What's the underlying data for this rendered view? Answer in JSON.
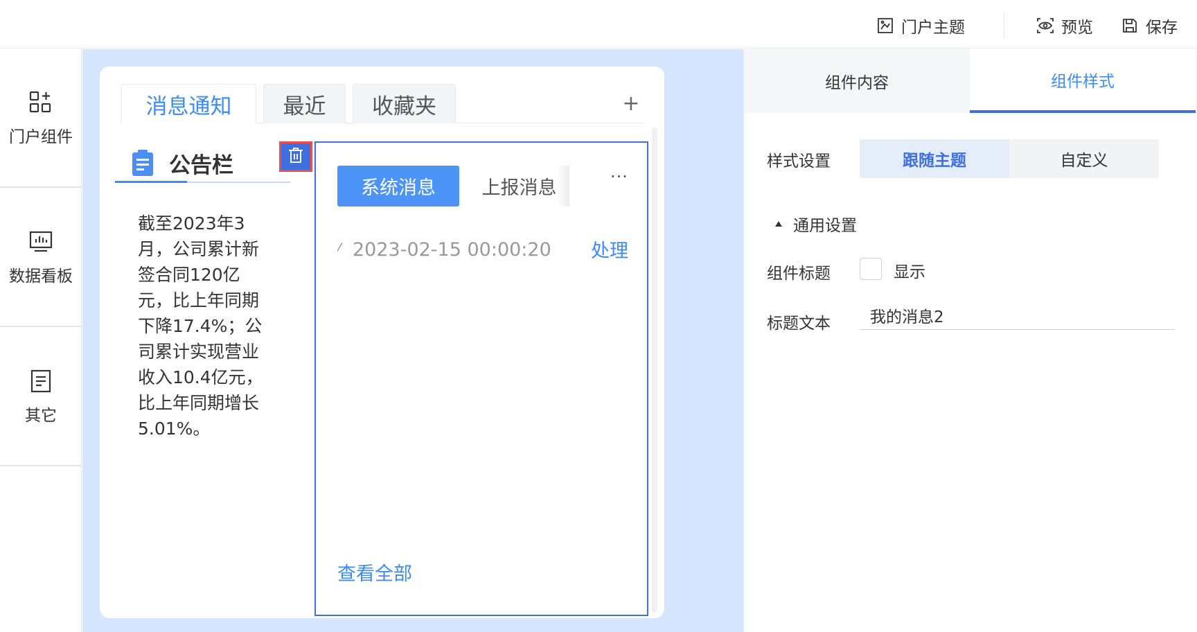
{
  "topbar": {
    "theme_label": "门户主题",
    "preview_label": "预览",
    "save_label": "保存"
  },
  "sidebar": {
    "items": [
      {
        "label": "门户组件",
        "icon": "widgets-icon"
      },
      {
        "label": "数据看板",
        "icon": "dashboard-icon"
      },
      {
        "label": "其它",
        "icon": "document-icon"
      }
    ]
  },
  "canvas": {
    "tabs": [
      {
        "label": "消息通知",
        "active": true
      },
      {
        "label": "最近",
        "active": false
      },
      {
        "label": "收藏夹",
        "active": false
      }
    ],
    "add_tab": "+",
    "bulletin": {
      "title": "公告栏",
      "body": "截至2023年3月，公司累计新签合同120亿元，比上年同期下降17.4%；公司累计实现营业收入10.4亿元，比上年同期增长5.01%。"
    },
    "messages": {
      "tab_system": "系统消息",
      "tab_report": "上报消息",
      "more": "···",
      "row_prefix": "⁄",
      "row_time": "2023-02-15 00:00:20",
      "row_action": "处理",
      "view_all": "查看全部"
    }
  },
  "right_panel": {
    "tabs": [
      {
        "label": "组件内容",
        "active": false
      },
      {
        "label": "组件样式",
        "active": true
      }
    ],
    "style_setting_label": "样式设置",
    "style_options": [
      {
        "label": "跟随主题",
        "active": true
      },
      {
        "label": "自定义",
        "active": false
      }
    ],
    "general_section": "通用设置",
    "component_title_label": "组件标题",
    "show_label": "显示",
    "show_checked": false,
    "title_text_label": "标题文本",
    "title_text_value": "我的消息2"
  },
  "colors": {
    "accent": "#3d8bf5",
    "accent_dark": "#3d6fe0",
    "canvas_bg": "#d6e6ff",
    "highlight_border": "#ef4d4a"
  }
}
